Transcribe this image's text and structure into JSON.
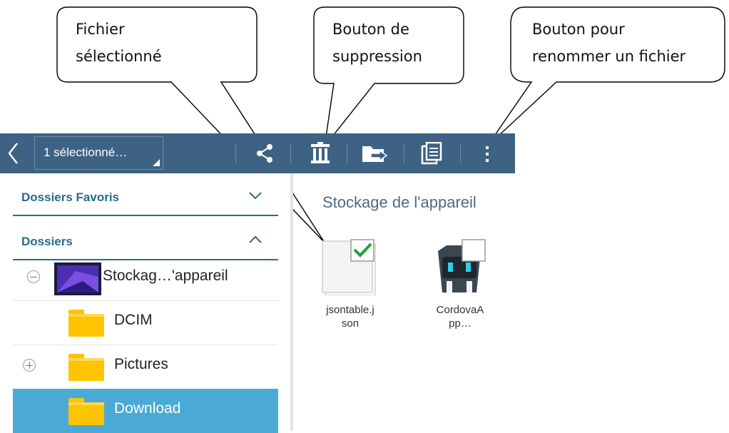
{
  "callouts": {
    "selected_file": [
      "Fichier",
      "sélectionné"
    ],
    "delete_button": [
      "Bouton de",
      "suppression"
    ],
    "rename_button": [
      "Bouton pour",
      "renommer un fichier"
    ]
  },
  "toolbar": {
    "selection_label": "1 sélectionné…",
    "icons": [
      "back-icon",
      "share-icon",
      "delete-icon",
      "move-icon",
      "copy-icon",
      "more-icon"
    ],
    "color": "#3d6283"
  },
  "sidebar": {
    "favorites_header": "Dossiers Favoris",
    "folders_header": "Dossiers",
    "storage_label": "Stockag…'appareil",
    "items": [
      {
        "label": "DCIM"
      },
      {
        "label": "Pictures"
      },
      {
        "label": "Download"
      }
    ],
    "selected_color": "#4aaad5"
  },
  "main": {
    "title": "Stockage de l'appareil",
    "files": [
      {
        "name_lines": [
          "jsontable.j",
          "son"
        ],
        "selected": true
      },
      {
        "name_lines": [
          "CordovaA",
          "pp…"
        ],
        "selected": false
      }
    ]
  }
}
